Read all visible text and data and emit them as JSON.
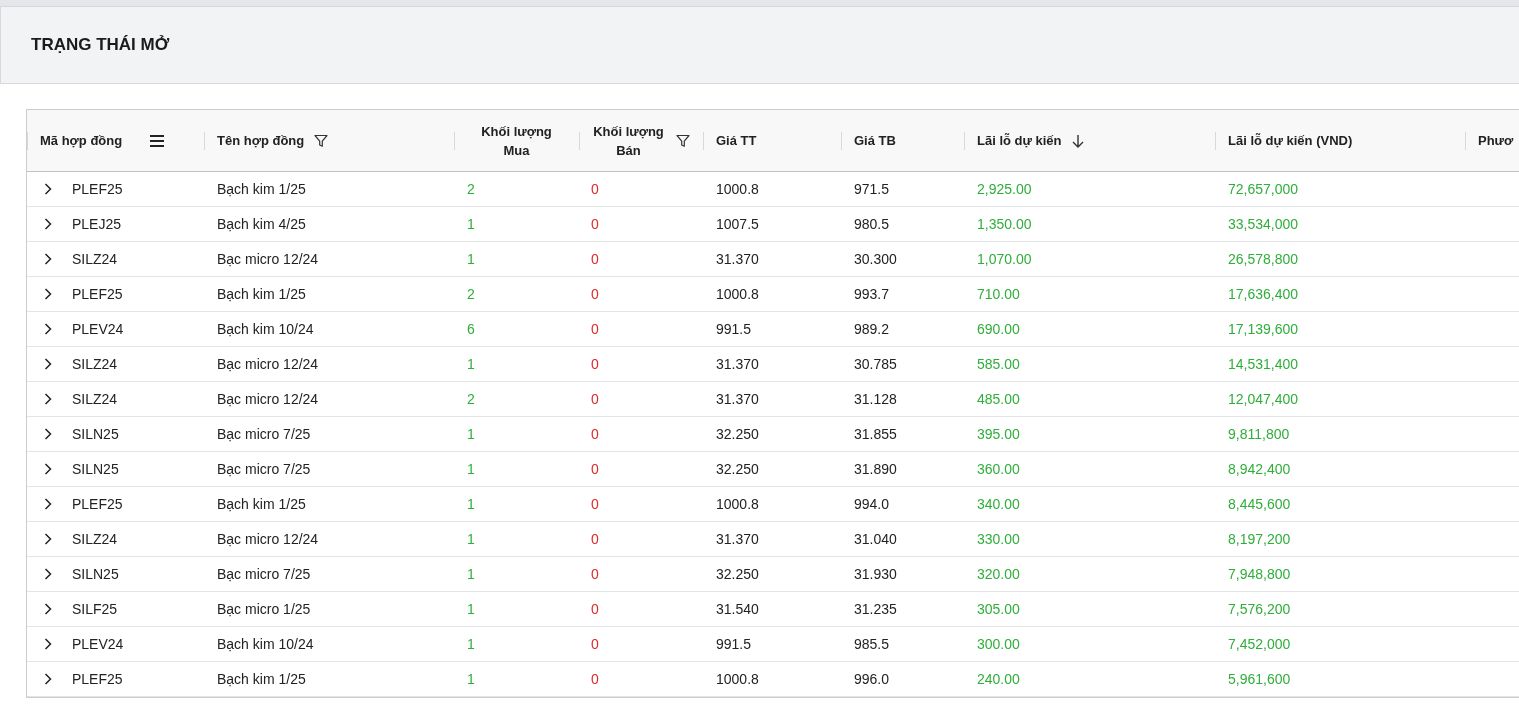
{
  "panel": {
    "title": "TRẠNG THÁI MỞ"
  },
  "table": {
    "columns": [
      {
        "label": "Mã hợp đồng",
        "kind": "code"
      },
      {
        "label": "Tên hợp đồng",
        "kind": "text"
      },
      {
        "label": "Khối lượng Mua",
        "kind": "buy"
      },
      {
        "label": "Khối lượng Bán",
        "kind": "sell"
      },
      {
        "label": "Giá TT",
        "kind": "number"
      },
      {
        "label": "Giá TB",
        "kind": "number"
      },
      {
        "label": "Lãi lỗ dự kiến",
        "kind": "profit"
      },
      {
        "label": "Lãi lỗ dự kiến (VND)",
        "kind": "profit"
      },
      {
        "label": "Phươ",
        "kind": "text"
      }
    ],
    "rows": [
      {
        "expanded": false,
        "cells": [
          "PLEF25",
          "Bạch kim 1/25",
          "2",
          "0",
          "1000.8",
          "971.5",
          "2,925.00",
          "72,657,000"
        ]
      },
      {
        "expanded": false,
        "cells": [
          "PLEJ25",
          "Bạch kim 4/25",
          "1",
          "0",
          "1007.5",
          "980.5",
          "1,350.00",
          "33,534,000"
        ]
      },
      {
        "expanded": false,
        "cells": [
          "SILZ24",
          "Bạc micro 12/24",
          "1",
          "0",
          "31.370",
          "30.300",
          "1,070.00",
          "26,578,800"
        ]
      },
      {
        "expanded": false,
        "cells": [
          "PLEF25",
          "Bạch kim 1/25",
          "2",
          "0",
          "1000.8",
          "993.7",
          "710.00",
          "17,636,400"
        ]
      },
      {
        "expanded": false,
        "cells": [
          "PLEV24",
          "Bạch kim 10/24",
          "6",
          "0",
          "991.5",
          "989.2",
          "690.00",
          "17,139,600"
        ]
      },
      {
        "expanded": false,
        "cells": [
          "SILZ24",
          "Bạc micro 12/24",
          "1",
          "0",
          "31.370",
          "30.785",
          "585.00",
          "14,531,400"
        ]
      },
      {
        "expanded": false,
        "cells": [
          "SILZ24",
          "Bạc micro 12/24",
          "2",
          "0",
          "31.370",
          "31.128",
          "485.00",
          "12,047,400"
        ]
      },
      {
        "expanded": false,
        "cells": [
          "SILN25",
          "Bạc micro 7/25",
          "1",
          "0",
          "32.250",
          "31.855",
          "395.00",
          "9,811,800"
        ]
      },
      {
        "expanded": false,
        "cells": [
          "SILN25",
          "Bạc micro 7/25",
          "1",
          "0",
          "32.250",
          "31.890",
          "360.00",
          "8,942,400"
        ]
      },
      {
        "expanded": false,
        "cells": [
          "PLEF25",
          "Bạch kim 1/25",
          "1",
          "0",
          "1000.8",
          "994.0",
          "340.00",
          "8,445,600"
        ]
      },
      {
        "expanded": false,
        "cells": [
          "SILZ24",
          "Bạc micro 12/24",
          "1",
          "0",
          "31.370",
          "31.040",
          "330.00",
          "8,197,200"
        ]
      },
      {
        "expanded": false,
        "cells": [
          "SILN25",
          "Bạc micro 7/25",
          "1",
          "0",
          "32.250",
          "31.930",
          "320.00",
          "7,948,800"
        ]
      },
      {
        "expanded": false,
        "cells": [
          "SILF25",
          "Bạc micro 1/25",
          "1",
          "0",
          "31.540",
          "31.235",
          "305.00",
          "7,576,200"
        ]
      },
      {
        "expanded": false,
        "cells": [
          "PLEV24",
          "Bạch kim 10/24",
          "1",
          "0",
          "991.5",
          "985.5",
          "300.00",
          "7,452,000"
        ]
      },
      {
        "expanded": false,
        "cells": [
          "PLEF25",
          "Bạch kim 1/25",
          "1",
          "0",
          "1000.8",
          "996.0",
          "240.00",
          "5,961,600"
        ]
      }
    ]
  }
}
